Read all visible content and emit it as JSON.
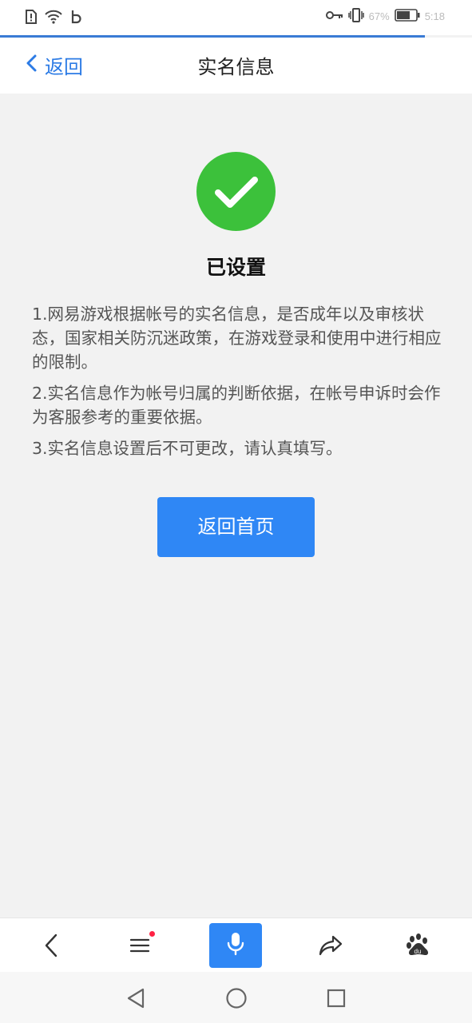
{
  "status_bar": {
    "battery_percent": "67%",
    "time": "5:18",
    "icons": [
      "alert-sim-icon",
      "wifi-icon",
      "b-app-icon",
      "key-icon",
      "vibrate-icon",
      "battery-icon"
    ]
  },
  "header": {
    "back_label": "返回",
    "title": "实名信息"
  },
  "main": {
    "status_text": "已设置",
    "notes": [
      "1.网易游戏根据帐号的实名信息，是否成年以及审核状态，国家相关防沉迷政策，在游戏登录和使用中进行相应的限制。",
      "2.实名信息作为帐号归属的判断依据，在帐号申诉时会作为客服参考的重要依据。",
      "3.实名信息设置后不可更改，请认真填写。"
    ],
    "home_button_label": "返回首页"
  },
  "colors": {
    "accent": "#2f87f5",
    "success": "#3cc13b",
    "background": "#f2f2f2"
  },
  "browser_bar": {
    "icons": [
      "back-arrow-icon",
      "menu-icon",
      "mic-icon",
      "share-icon",
      "baidu-paw-icon"
    ]
  },
  "system_nav": {
    "icons": [
      "nav-back-icon",
      "nav-home-icon",
      "nav-recents-icon"
    ]
  }
}
